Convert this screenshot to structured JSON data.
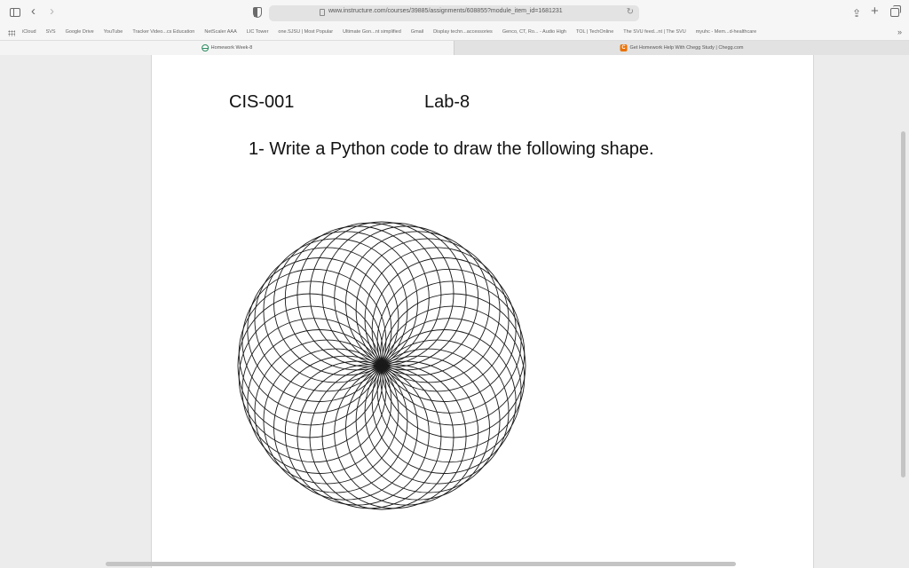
{
  "browser": {
    "url": "www.instructure.com/courses/39885/assignments/608855?module_item_id=1681231"
  },
  "favorites": [
    "iCloud",
    "SVS",
    "Google Drive",
    "YouTube",
    "Tracker Video...cs Education",
    "NetScaler AAA",
    "LIC Tower",
    "one.SJSU | Most Popular",
    "Ultimate Gon...nt simplified",
    "Gmail",
    "Display techn...accessories",
    "Genco, CT, Ro... - Audio High",
    "TOL | TechOnline",
    "The SVU feed...nt | The SVU",
    "myuhc - Mem...d-healthcare"
  ],
  "tabs": [
    {
      "title": "Homework Week-8",
      "active": true,
      "icon": "globe-icon"
    },
    {
      "title": "Get Homework Help With Chegg Study | Chegg.com",
      "active": false,
      "icon": "chegg-icon"
    }
  ],
  "document": {
    "course": "CIS-001",
    "lab": "Lab-8",
    "task": "1- Write a Python code to draw the following shape."
  },
  "drawing": {
    "shape": "spirograph of overlapping circles",
    "circle_count": 36,
    "stroke_color": "#1a1a1a"
  },
  "colors": {
    "chrome_bg": "#f6f6f6",
    "page_bg": "#ffffff",
    "window_bg": "#ececec",
    "chegg_accent": "#eb7100"
  }
}
